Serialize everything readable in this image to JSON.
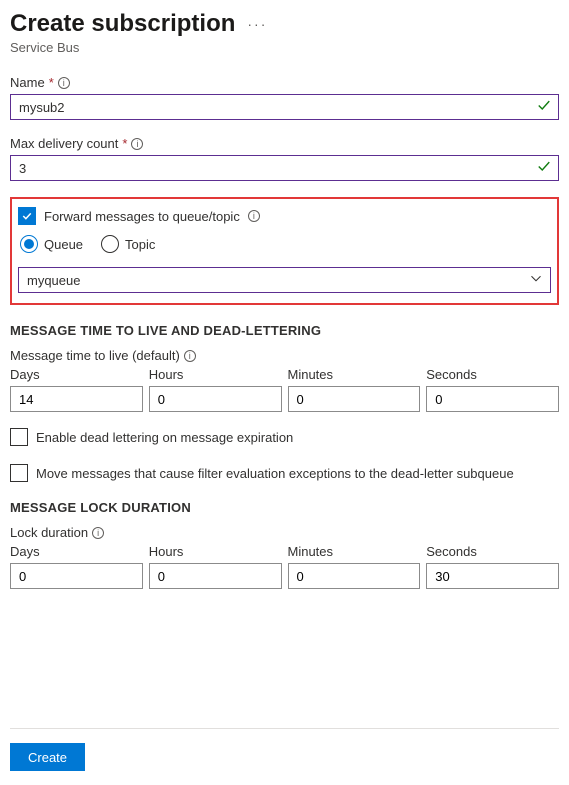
{
  "header": {
    "title": "Create subscription",
    "subtitle": "Service Bus"
  },
  "fields": {
    "name_label": "Name",
    "name_value": "mysub2",
    "max_delivery_label": "Max delivery count",
    "max_delivery_value": "3"
  },
  "forward": {
    "checkbox_label": "Forward messages to queue/topic",
    "checked": true,
    "radio_queue": "Queue",
    "radio_topic": "Topic",
    "selected": "Queue",
    "dropdown_value": "myqueue"
  },
  "ttl": {
    "section_title": "MESSAGE TIME TO LIVE AND DEAD-LETTERING",
    "ttl_label": "Message time to live (default)",
    "cols": {
      "days": "Days",
      "hours": "Hours",
      "minutes": "Minutes",
      "seconds": "Seconds"
    },
    "values": {
      "days": "14",
      "hours": "0",
      "minutes": "0",
      "seconds": "0"
    },
    "dead_letter_label": "Enable dead lettering on message expiration",
    "filter_ex_label": "Move messages that cause filter evaluation exceptions to the dead-letter subqueue"
  },
  "lock": {
    "section_title": "MESSAGE LOCK DURATION",
    "lock_label": "Lock duration",
    "values": {
      "days": "0",
      "hours": "0",
      "minutes": "0",
      "seconds": "30"
    }
  },
  "footer": {
    "create": "Create"
  }
}
